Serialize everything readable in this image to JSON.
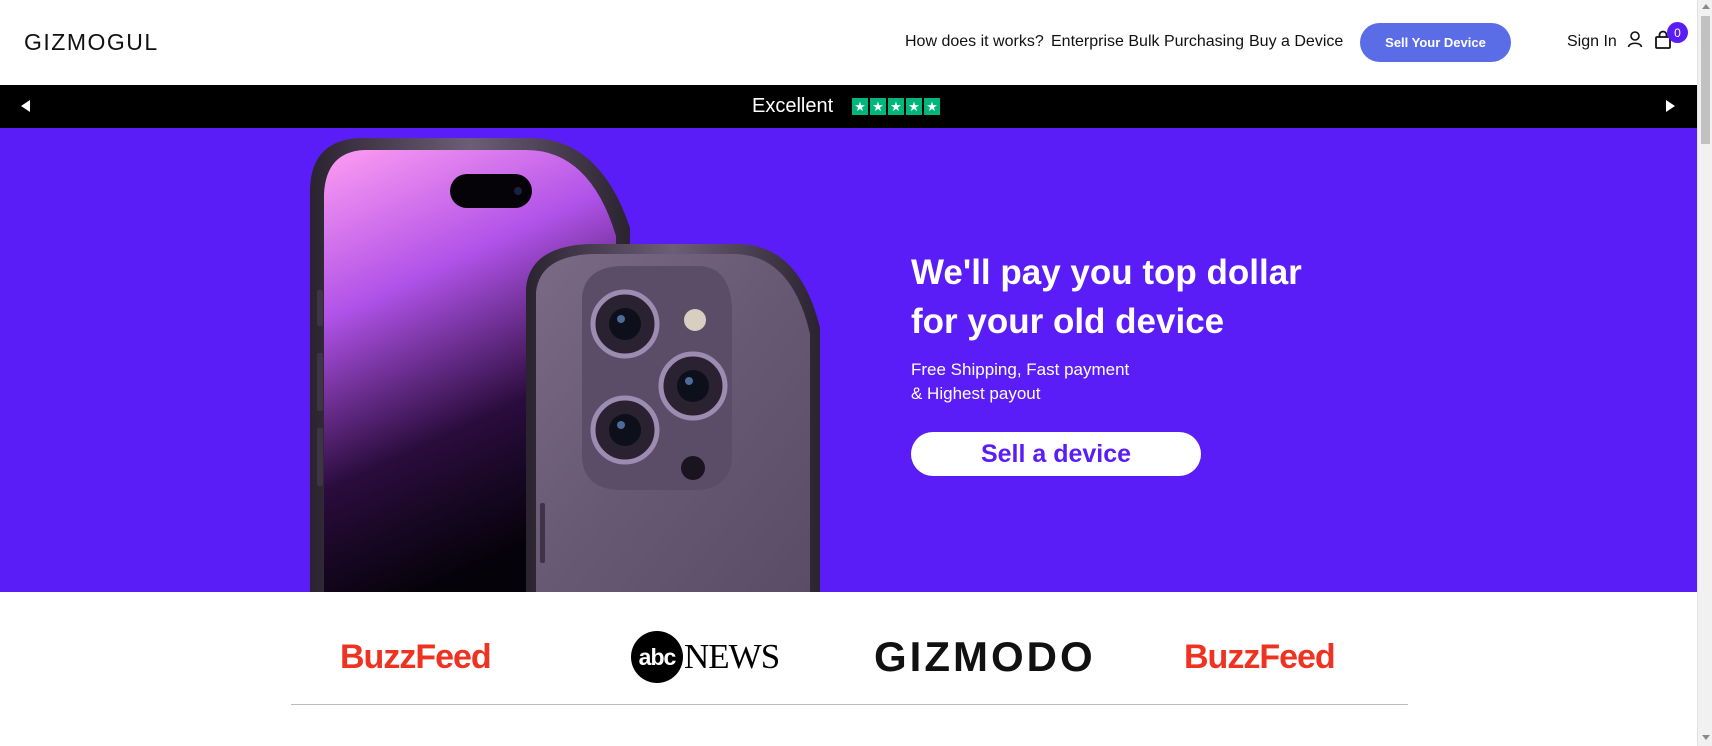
{
  "header": {
    "logo": "GIZMOGUL",
    "nav": {
      "how_it_works": "How does it works?",
      "enterprise": "Enterprise Bulk Purchasing",
      "buy": "Buy a Device"
    },
    "sell_button": "Sell Your Device",
    "sign_in": "Sign In",
    "user_icon": "user-icon",
    "cart_icon": "shopping-bag-icon",
    "cart_count": "0"
  },
  "rating_bar": {
    "label": "Excellent",
    "stars": [
      "★",
      "★",
      "★",
      "★",
      "★"
    ],
    "rating": 5,
    "prev_icon": "caret-left-icon",
    "next_icon": "caret-right-icon"
  },
  "hero": {
    "title_lines": [
      "We'll pay you top dollar",
      "for your old device"
    ],
    "subtitle_lines": [
      "Free Shipping, Fast payment",
      "& Highest payout"
    ],
    "cta": "Sell a device",
    "image": "purple-iphone-pro-image"
  },
  "press": {
    "logos": [
      "BuzzFeed",
      "abc NEWS",
      "GIZMODO",
      "BuzzFeed"
    ],
    "abc_circle": "abc",
    "abc_word": "NEWS"
  },
  "colors": {
    "hero_bg": "#5b1df7",
    "sell_button_bg": "#5a6de6",
    "rating_bar_bg": "#000000",
    "trustpilot_green": "#00b67a",
    "buzzfeed_red": "#ee3322",
    "cta_text": "#5a1df8"
  }
}
